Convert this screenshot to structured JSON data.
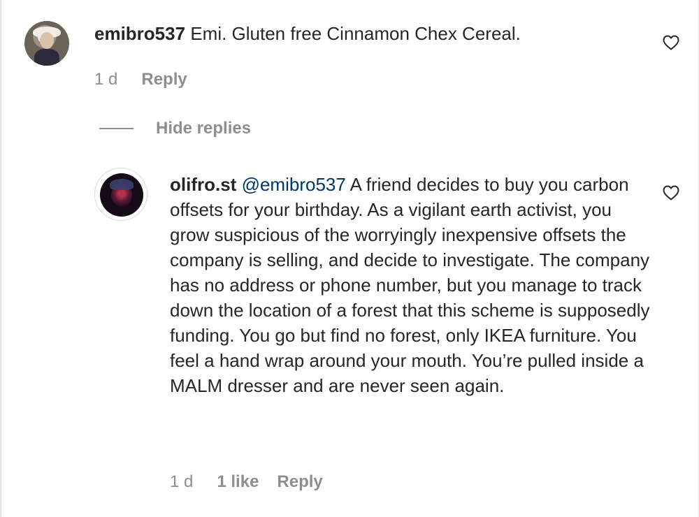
{
  "comments": [
    {
      "username": "emibro537",
      "text": "Emi. Gluten free Cinnamon Chex Cereal.",
      "time": "1 d",
      "reply_label": "Reply"
    }
  ],
  "thread": {
    "hide_replies_label": "Hide replies"
  },
  "replies": [
    {
      "username": "olifro.st",
      "mention": "@emibro537",
      "text": "A friend decides to buy you carbon offsets for your birthday. As a vigilant earth activist, you grow suspicious of the worryingly inexpensive offsets the company is selling, and decide to investigate. The company has no address or phone number, but you manage to track down the location of a forest that this scheme is supposedly funding. You go but find no forest, only IKEA furniture. You feel a hand wrap around your mouth. You’re pulled inside a MALM dresser and are never seen again.",
      "time": "1 d",
      "likes": "1 like",
      "reply_label": "Reply"
    }
  ],
  "icons": {
    "like": "heart-outline-icon"
  },
  "colors": {
    "text": "#262626",
    "secondary": "#8e8e8e",
    "mention": "#00376b"
  }
}
